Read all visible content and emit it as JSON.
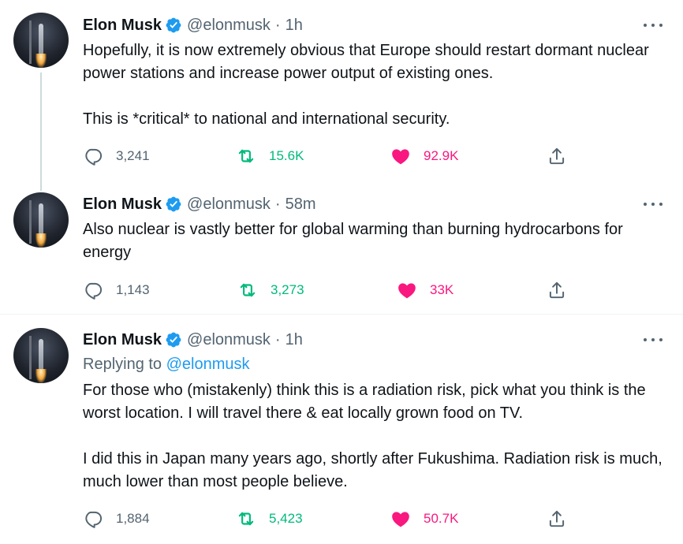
{
  "tweets": [
    {
      "author": {
        "name": "Elon Musk",
        "handle": "@elonmusk"
      },
      "separator": "·",
      "time": "1h",
      "replying_to": null,
      "paragraphs": [
        "Hopefully, it is now extremely obvious that Europe should restart dormant nuclear power stations and increase power output of existing ones.",
        "This is *critical* to national and international security."
      ],
      "stats": {
        "replies": "3,241",
        "retweets": "15.6K",
        "likes": "92.9K"
      }
    },
    {
      "author": {
        "name": "Elon Musk",
        "handle": "@elonmusk"
      },
      "separator": "·",
      "time": "58m",
      "replying_to": null,
      "paragraphs": [
        "Also nuclear is vastly better for global warming than burning hydrocarbons for energy"
      ],
      "stats": {
        "replies": "1,143",
        "retweets": "3,273",
        "likes": "33K"
      }
    },
    {
      "author": {
        "name": "Elon Musk",
        "handle": "@elonmusk"
      },
      "separator": "·",
      "time": "1h",
      "replying_to": {
        "prefix": "Replying to",
        "mention": "@elonmusk"
      },
      "paragraphs": [
        "For those who (mistakenly) think this is a radiation risk, pick what you think is the worst location. I will travel there & eat locally grown food on TV.",
        "I did this in Japan many years ago, shortly after Fukushima. Radiation risk is much, much lower than most people believe."
      ],
      "stats": {
        "replies": "1,884",
        "retweets": "5,423",
        "likes": "50.7K"
      }
    }
  ],
  "colors": {
    "text": "#0f1419",
    "secondary": "#536471",
    "verified": "#1d9bf0",
    "retweet": "#00ba7c",
    "like": "#f91880",
    "thread_line": "#cfd9de"
  },
  "icons": {
    "verified": "verified-badge-icon",
    "more": "more-dots-icon",
    "reply": "reply-bubble-icon",
    "retweet": "retweet-arrows-icon",
    "like": "heart-filled-icon",
    "share": "share-upload-icon"
  }
}
